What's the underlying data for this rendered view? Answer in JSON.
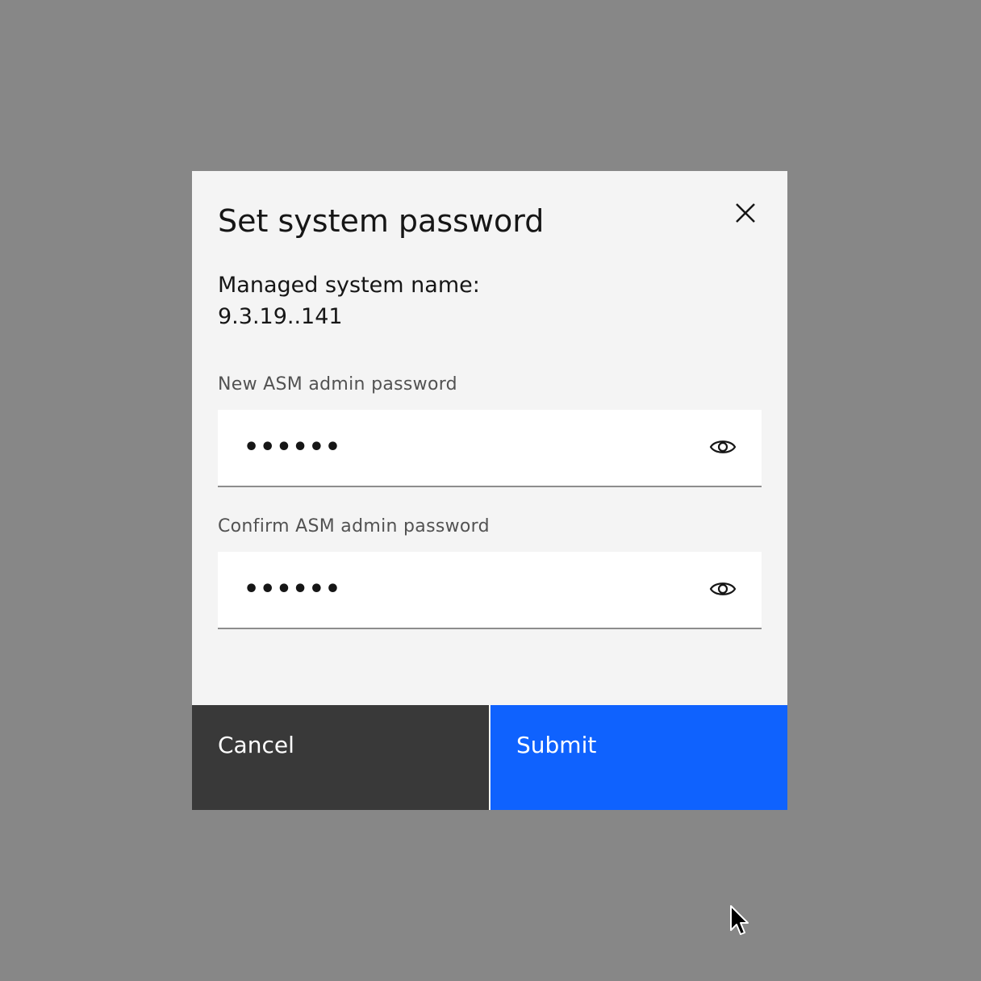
{
  "modal": {
    "title": "Set system password",
    "system_name_label": "Managed system name:",
    "system_name_value": "9.3.19..141"
  },
  "fields": {
    "new_password": {
      "label": "New ASM admin password",
      "value": "••••••"
    },
    "confirm_password": {
      "label": "Confirm ASM admin password",
      "value": "••••••"
    }
  },
  "buttons": {
    "cancel": "Cancel",
    "submit": "Submit"
  },
  "icons": {
    "close": "close-icon",
    "reveal": "eye-icon",
    "pointer": "mouse-cursor-icon"
  },
  "colors": {
    "overlay": "#878787",
    "modal_background": "#f4f4f4",
    "secondary_button": "#393939",
    "primary_button": "#0f62fe"
  }
}
